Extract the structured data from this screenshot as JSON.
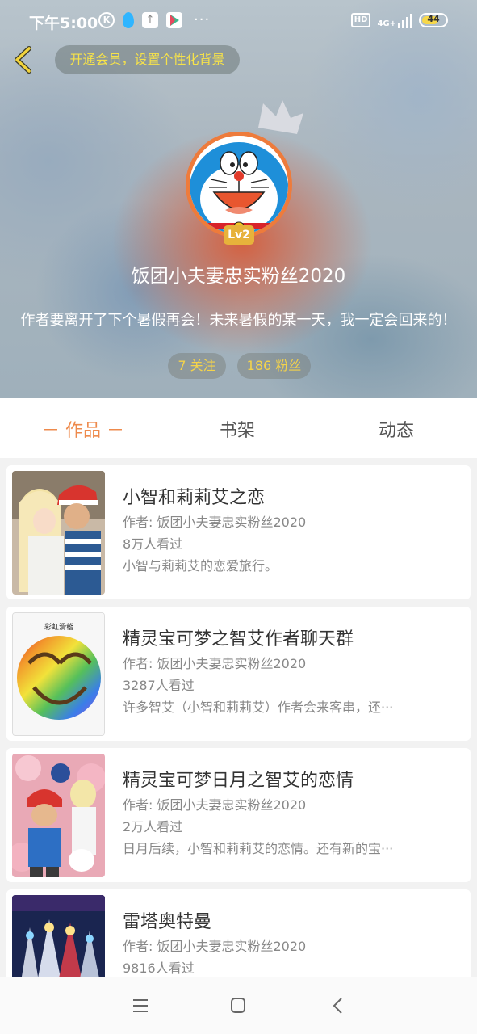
{
  "status_bar": {
    "time": "下午5:00",
    "k_icon": "K",
    "hd": "HD",
    "network": "4G+",
    "battery": "44"
  },
  "header": {
    "vip_prompt": "开通会员，设置个性化背景",
    "level": "Lv2",
    "username": "饭团小夫妻忠实粉丝2020",
    "bio": "作者要离开了下个暑假再会！未来暑假的某一天，我一定会回来的！",
    "following": "7 关注",
    "fans": "186 粉丝"
  },
  "tabs": [
    {
      "label": "－ 作品 －",
      "active": true
    },
    {
      "label": "书架",
      "active": false
    },
    {
      "label": "动态",
      "active": false
    }
  ],
  "works": [
    {
      "title": "小智和莉莉艾之恋",
      "author": "作者: 饭团小夫妻忠实粉丝2020",
      "views": "8万人看过",
      "desc": "小智与莉莉艾的恋爱旅行。"
    },
    {
      "title": "精灵宝可梦之智艾作者聊天群",
      "author": "作者: 饭团小夫妻忠实粉丝2020",
      "views": "3287人看过",
      "desc": "许多智艾（小智和莉莉艾）作者会来客串，还···",
      "thumb_label": "彩虹滑稽"
    },
    {
      "title": "精灵宝可梦日月之智艾的恋情",
      "author": "作者: 饭团小夫妻忠实粉丝2020",
      "views": "2万人看过",
      "desc": "日月后续，小智和莉莉艾的恋情。还有新的宝···"
    },
    {
      "title": "雷塔奥特曼",
      "author": "作者: 饭团小夫妻忠实粉丝2020",
      "views": "9816人看过",
      "desc": ""
    }
  ],
  "colors": {
    "accent": "#ee8a4c",
    "gold": "#f4d34a",
    "avatar_ring": "#ee7b3b"
  },
  "icons": {
    "back": "chevron-left-icon",
    "crown": "crown-icon",
    "nav_menu": "menu-icon",
    "nav_home": "square-home-icon",
    "nav_back": "back-icon"
  }
}
